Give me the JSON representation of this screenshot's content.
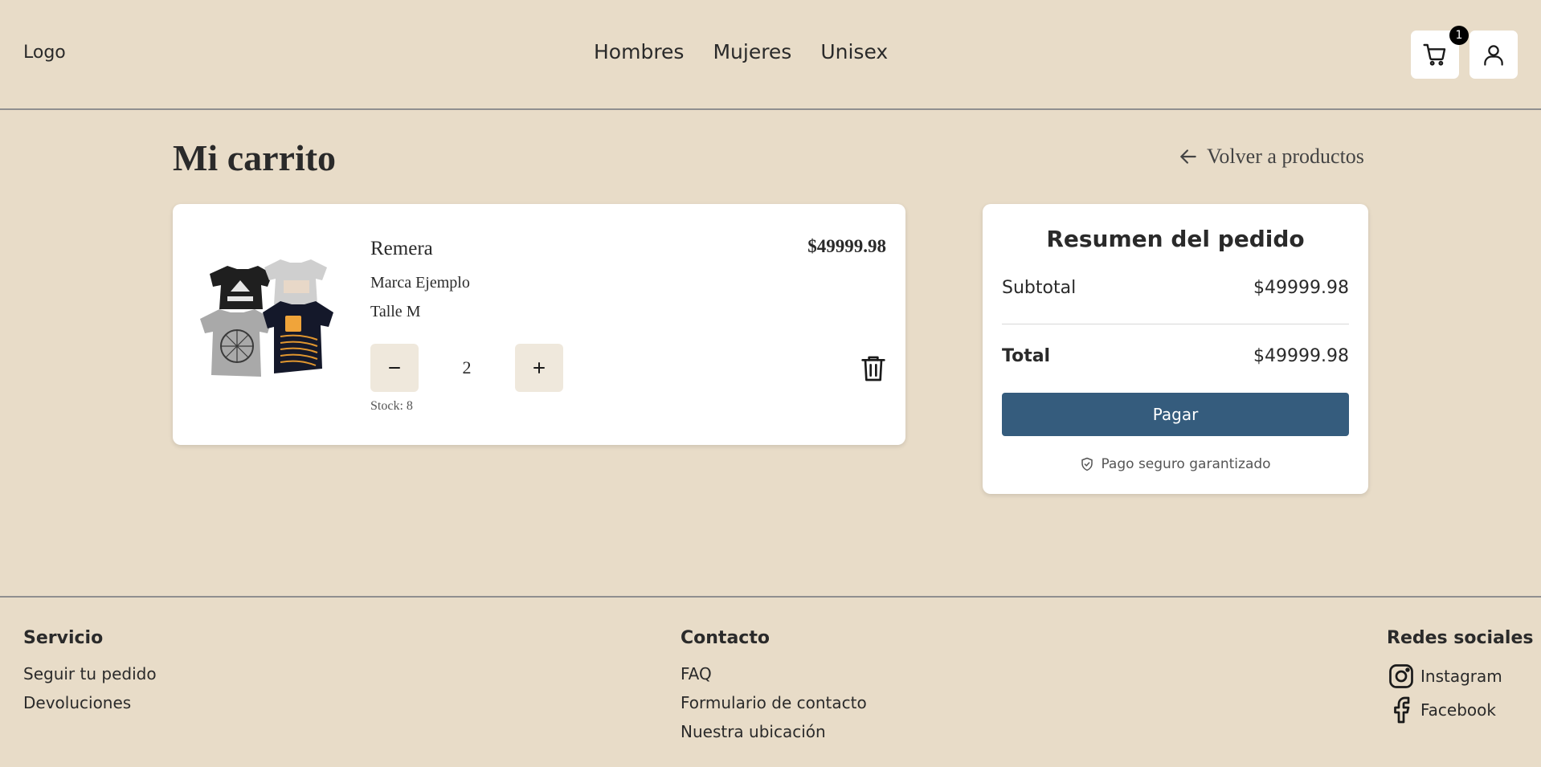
{
  "header": {
    "logo": "Logo",
    "nav": [
      "Hombres",
      "Mujeres",
      "Unisex"
    ],
    "cart_count": "1",
    "cart_icon": "cart-icon",
    "user_icon": "user-icon"
  },
  "main": {
    "title": "Mi carrito",
    "back_link": "Volver a productos",
    "back_icon": "arrow-left-icon"
  },
  "cart_item": {
    "name": "Remera",
    "brand": "Marca Ejemplo",
    "size": "Talle M",
    "price": "$49999.98",
    "quantity": "2",
    "stock": "Stock: 8",
    "image": "tshirts-image",
    "minus_icon": "minus-icon",
    "plus_icon": "plus-icon",
    "delete_icon": "trash-icon"
  },
  "summary": {
    "title": "Resumen del pedido",
    "subtotal_label": "Subtotal",
    "subtotal_value": "$49999.98",
    "total_label": "Total",
    "total_value": "$49999.98",
    "pay_label": "Pagar",
    "secure_note": "Pago seguro garantizado",
    "secure_icon": "shield-check-icon"
  },
  "footer": {
    "servicio": {
      "heading": "Servicio",
      "links": [
        "Seguir tu pedido",
        "Devoluciones"
      ]
    },
    "contacto": {
      "heading": "Contacto",
      "links": [
        "FAQ",
        "Formulario de contacto",
        "Nuestra ubicación"
      ]
    },
    "redes": {
      "heading": "Redes sociales",
      "links": [
        "Instagram",
        "Facebook"
      ]
    }
  },
  "colors": {
    "background": "#e8dcc8",
    "pay_button": "#355c7d",
    "card": "#ffffff",
    "qty_button": "#efe8dc"
  }
}
